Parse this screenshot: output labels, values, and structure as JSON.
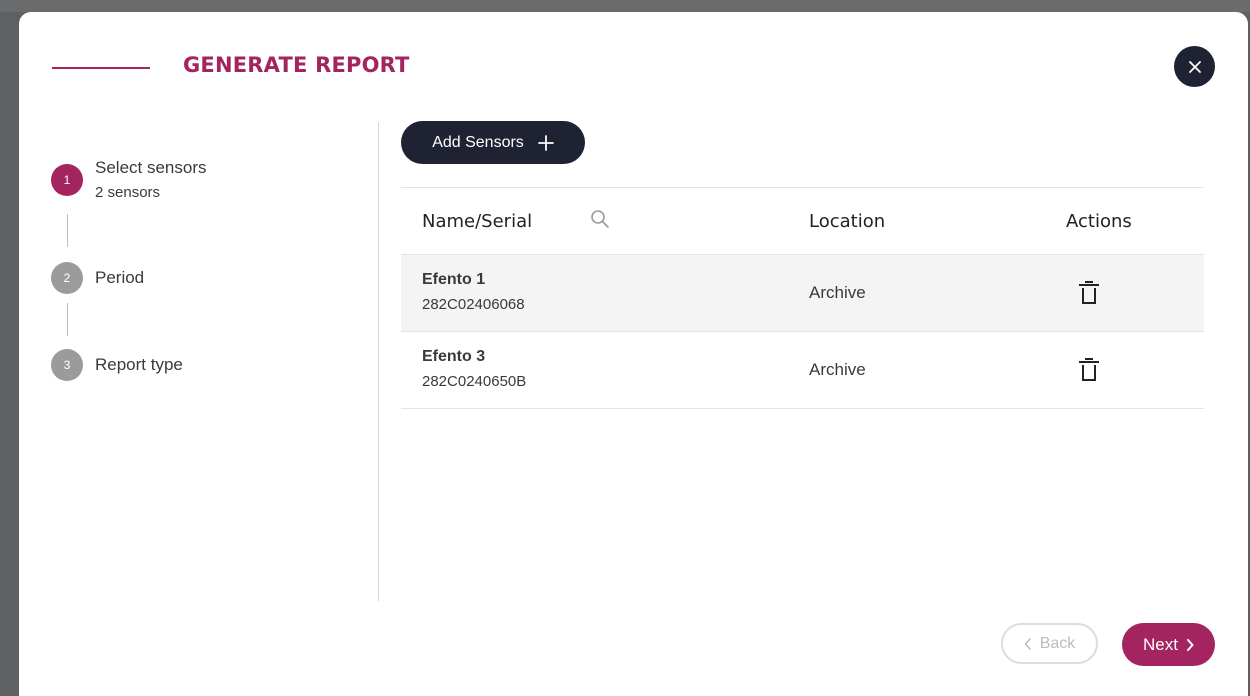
{
  "dialog": {
    "title": "GENERATE REPORT",
    "accent_color": "#a3245f",
    "dark_color": "#1f2233",
    "close_icon": "close-icon"
  },
  "stepper": {
    "steps": [
      {
        "number": "1",
        "label": "Select sensors",
        "sublabel": "2 sensors",
        "active": true
      },
      {
        "number": "2",
        "label": "Period",
        "active": false
      },
      {
        "number": "3",
        "label": "Report type",
        "active": false
      }
    ]
  },
  "toolbar": {
    "add_sensors_label": "Add Sensors",
    "add_icon": "plus-icon"
  },
  "table": {
    "columns": [
      "Name/Serial",
      "Location",
      "Actions"
    ],
    "search_icon": "search-icon",
    "rows": [
      {
        "name": "Efento 1",
        "serial": "282C02406068",
        "location": "Archive",
        "action_icon": "trash-icon"
      },
      {
        "name": "Efento 3",
        "serial": "282C0240650B",
        "location": "Archive",
        "action_icon": "trash-icon"
      }
    ]
  },
  "footer": {
    "back_label": "Back",
    "next_label": "Next"
  }
}
